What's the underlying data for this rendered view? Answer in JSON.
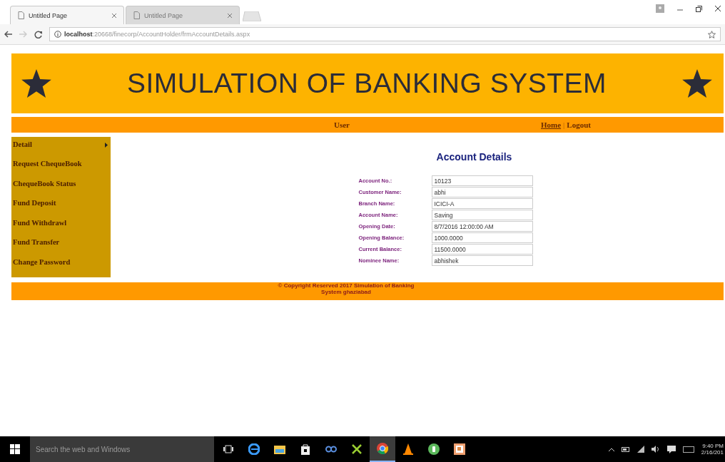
{
  "browser": {
    "tabs": [
      {
        "title": "Untitled Page",
        "selected": true
      },
      {
        "title": "Untitled Page",
        "selected": false
      }
    ],
    "address": {
      "host": "localhost",
      "path": ":20668/finecorp/AccountHolder/frmAccountDetails.aspx"
    }
  },
  "banner": {
    "title": "SIMULATION OF BANKING SYSTEM"
  },
  "navbar": {
    "role": "User",
    "links": [
      "Home",
      "Logout"
    ],
    "separator": "|"
  },
  "sidebar": {
    "items": [
      {
        "label": "Detail",
        "submenu": true
      },
      {
        "label": "Request ChequeBook",
        "submenu": false
      },
      {
        "label": "ChequeBook Status",
        "submenu": false
      },
      {
        "label": "Fund Deposit",
        "submenu": false
      },
      {
        "label": "Fund Withdrawl",
        "submenu": false
      },
      {
        "label": "Fund Transfer",
        "submenu": false
      },
      {
        "label": "Change Password",
        "submenu": false
      }
    ]
  },
  "form": {
    "heading": "Account Details",
    "fields": [
      {
        "label": "Account No.:",
        "value": "10123"
      },
      {
        "label": "Customer Name:",
        "value": "abhi"
      },
      {
        "label": "Branch Name:",
        "value": "ICICI-A"
      },
      {
        "label": "Account Name:",
        "value": "Saving"
      },
      {
        "label": "Opening Date:",
        "value": "8/7/2016 12:00:00 AM"
      },
      {
        "label": "Opening Balance:",
        "value": "1000.0000"
      },
      {
        "label": "Current Balance:",
        "value": "11500.0000"
      },
      {
        "label": "Nominee Name:",
        "value": "abhishek"
      }
    ]
  },
  "footer": {
    "text": "© Copyright Reserved 2017 Simulation of Banking System ghaziabad"
  },
  "taskbar": {
    "search_placeholder": "Search the web and Windows",
    "apps": [
      {
        "kind": "taskview",
        "active": false
      },
      {
        "kind": "edge",
        "active": false
      },
      {
        "kind": "folder",
        "active": false
      },
      {
        "kind": "store",
        "active": false
      },
      {
        "kind": "link",
        "active": false
      },
      {
        "kind": "tool",
        "active": false
      },
      {
        "kind": "chrome",
        "active": true
      },
      {
        "kind": "cone",
        "active": false
      },
      {
        "kind": "phone",
        "active": false
      },
      {
        "kind": "slides",
        "active": false
      }
    ],
    "time": "9:40 PM",
    "date": "2/16/201"
  }
}
